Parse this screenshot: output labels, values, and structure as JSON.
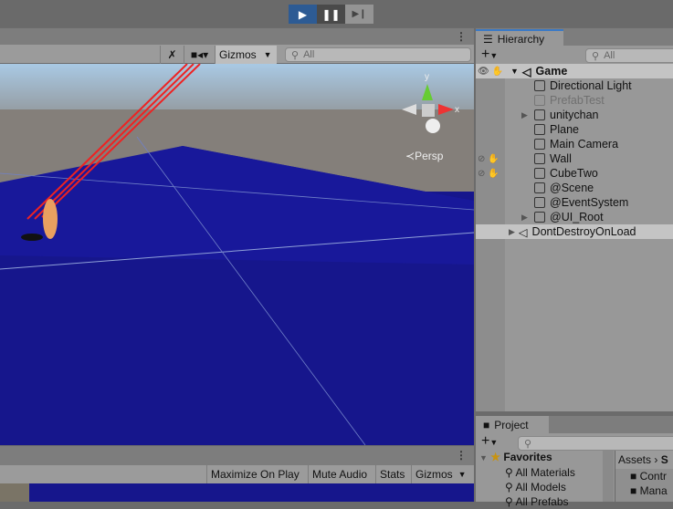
{
  "toolbar": {
    "play": "▶",
    "pause": "❚❚",
    "step": "▶❙"
  },
  "scene": {
    "gizmos": "Gizmos",
    "search_placeholder": "All",
    "persp": "Persp",
    "axis_y": "y",
    "axis_x": "x"
  },
  "hierarchy": {
    "title": "Hierarchy",
    "search_placeholder": "All",
    "root": "Game",
    "items": [
      {
        "label": "Directional Light",
        "expand": false,
        "dim": false,
        "hidden": false
      },
      {
        "label": "PrefabTest",
        "expand": false,
        "dim": true,
        "hidden": false
      },
      {
        "label": "unitychan",
        "expand": true,
        "dim": false,
        "hidden": false
      },
      {
        "label": "Plane",
        "expand": false,
        "dim": false,
        "hidden": false
      },
      {
        "label": "Main Camera",
        "expand": false,
        "dim": false,
        "hidden": false
      },
      {
        "label": "Wall",
        "expand": false,
        "dim": false,
        "hidden": true
      },
      {
        "label": "CubeTwo",
        "expand": false,
        "dim": false,
        "hidden": true
      },
      {
        "label": "@Scene",
        "expand": false,
        "dim": false,
        "hidden": false
      },
      {
        "label": "@EventSystem",
        "expand": false,
        "dim": false,
        "hidden": false
      },
      {
        "label": "@UI_Root",
        "expand": true,
        "dim": false,
        "hidden": false
      }
    ],
    "ddol": "DontDestroyOnLoad"
  },
  "project": {
    "title": "Project",
    "favorites": "Favorites",
    "items": [
      "All Materials",
      "All Models",
      "All Prefabs"
    ],
    "breadcrumb": [
      "Assets",
      "S"
    ],
    "folders": [
      "Contr",
      "Mana"
    ]
  },
  "game": {
    "buttons": [
      "Maximize On Play",
      "Mute Audio",
      "Stats",
      "Gizmos"
    ]
  }
}
